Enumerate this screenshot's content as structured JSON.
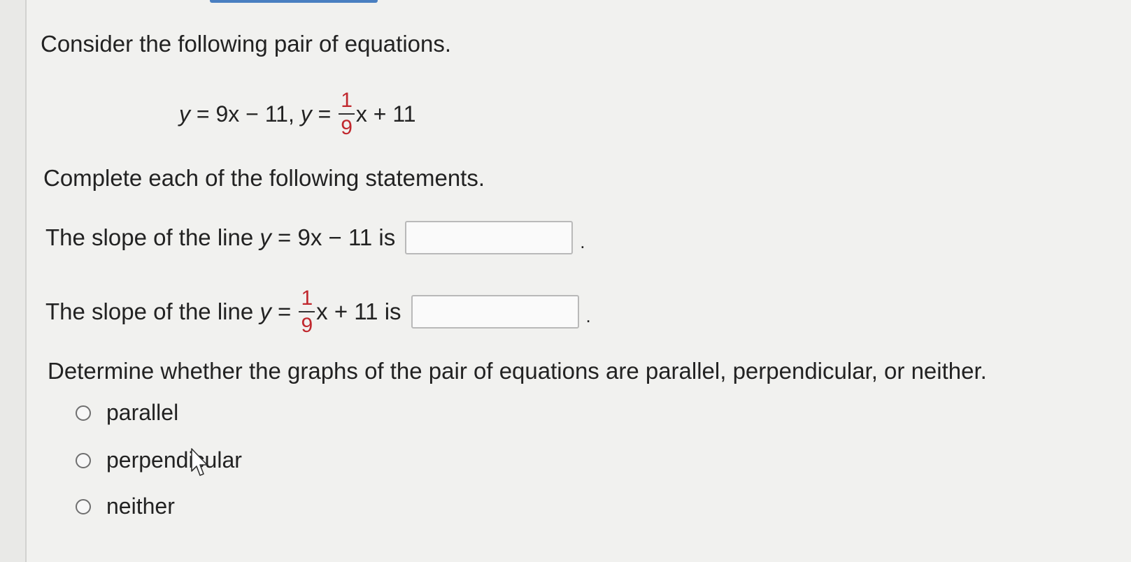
{
  "question": {
    "intro": "Consider the following pair of equations.",
    "equation": {
      "eq1_lhs": "y",
      "eq1_rest": " = 9x − 11, ",
      "eq2_lhs": "y",
      "eq2_eq": " = ",
      "frac_num": "1",
      "frac_den": "9",
      "eq2_tail": "x + 11"
    },
    "complete": "Complete each of the following statements.",
    "statement1": {
      "prefix": "The slope of the line ",
      "var": "y",
      "rest": " = 9x − 11 is",
      "end": "."
    },
    "statement2": {
      "prefix": "The slope of the line ",
      "var": "y",
      "eq": " = ",
      "frac_num": "1",
      "frac_den": "9",
      "tail": "x + 11 is",
      "end": "."
    },
    "determine": "Determine whether the graphs of the pair of equations are parallel, perpendicular, or neither.",
    "options": [
      "parallel",
      "perpendicular",
      "neither"
    ]
  },
  "colors": {
    "accent_red": "#c0272d",
    "top_bar": "#4a7fc1"
  }
}
